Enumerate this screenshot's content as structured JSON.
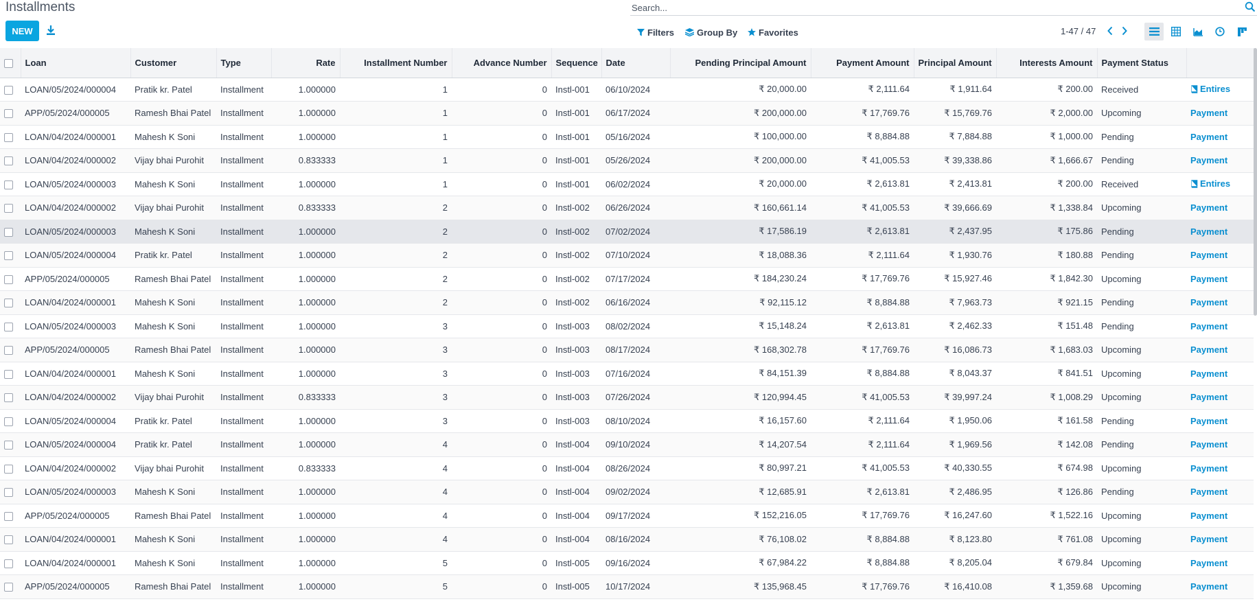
{
  "header": {
    "title": "Installments",
    "new_label": "NEW",
    "search_placeholder": "Search...",
    "filters_label": "Filters",
    "group_by_label": "Group By",
    "favorites_label": "Favorites",
    "pager": "1-47 / 47"
  },
  "colors": {
    "accent": "#0aa5e0",
    "link": "#0a8fd0"
  },
  "columns": [
    "Loan",
    "Customer",
    "Type",
    "Rate",
    "Installment Number",
    "Advance Number",
    "Sequence",
    "Date",
    "Pending Principal Amount",
    "Payment Amount",
    "Principal Amount",
    "Interests Amount",
    "Payment Status"
  ],
  "rows": [
    {
      "loan": "LOAN/05/2024/000004",
      "customer": "Pratik kr. Patel",
      "type": "Installment",
      "rate": "1.000000",
      "inst": "1",
      "adv": "0",
      "seq": "Instl-001",
      "date": "06/10/2024",
      "pending": "₹ 20,000.00",
      "payment": "₹ 2,111.64",
      "principal": "₹ 1,911.64",
      "interest": "₹ 200.00",
      "status": "Received",
      "action": "Entires"
    },
    {
      "loan": "APP/05/2024/000005",
      "customer": "Ramesh Bhai Patel",
      "type": "Installment",
      "rate": "1.000000",
      "inst": "1",
      "adv": "0",
      "seq": "Instl-001",
      "date": "06/17/2024",
      "pending": "₹ 200,000.00",
      "payment": "₹ 17,769.76",
      "principal": "₹ 15,769.76",
      "interest": "₹ 2,000.00",
      "status": "Upcoming",
      "action": "Payment"
    },
    {
      "loan": "LOAN/04/2024/000001",
      "customer": "Mahesh K Soni",
      "type": "Installment",
      "rate": "1.000000",
      "inst": "1",
      "adv": "0",
      "seq": "Instl-001",
      "date": "05/16/2024",
      "pending": "₹ 100,000.00",
      "payment": "₹ 8,884.88",
      "principal": "₹ 7,884.88",
      "interest": "₹ 1,000.00",
      "status": "Pending",
      "action": "Payment"
    },
    {
      "loan": "LOAN/04/2024/000002",
      "customer": "Vijay bhai Purohit",
      "type": "Installment",
      "rate": "0.833333",
      "inst": "1",
      "adv": "0",
      "seq": "Instl-001",
      "date": "05/26/2024",
      "pending": "₹ 200,000.00",
      "payment": "₹ 41,005.53",
      "principal": "₹ 39,338.86",
      "interest": "₹ 1,666.67",
      "status": "Pending",
      "action": "Payment"
    },
    {
      "loan": "LOAN/05/2024/000003",
      "customer": "Mahesh K Soni",
      "type": "Installment",
      "rate": "1.000000",
      "inst": "1",
      "adv": "0",
      "seq": "Instl-001",
      "date": "06/02/2024",
      "pending": "₹ 20,000.00",
      "payment": "₹ 2,613.81",
      "principal": "₹ 2,413.81",
      "interest": "₹ 200.00",
      "status": "Received",
      "action": "Entires"
    },
    {
      "loan": "LOAN/04/2024/000002",
      "customer": "Vijay bhai Purohit",
      "type": "Installment",
      "rate": "0.833333",
      "inst": "2",
      "adv": "0",
      "seq": "Instl-002",
      "date": "06/26/2024",
      "pending": "₹ 160,661.14",
      "payment": "₹ 41,005.53",
      "principal": "₹ 39,666.69",
      "interest": "₹ 1,338.84",
      "status": "Upcoming",
      "action": "Payment"
    },
    {
      "loan": "LOAN/05/2024/000003",
      "customer": "Mahesh K Soni",
      "type": "Installment",
      "rate": "1.000000",
      "inst": "2",
      "adv": "0",
      "seq": "Instl-002",
      "date": "07/02/2024",
      "pending": "₹ 17,586.19",
      "payment": "₹ 2,613.81",
      "principal": "₹ 2,437.95",
      "interest": "₹ 175.86",
      "status": "Pending",
      "action": "Payment"
    },
    {
      "loan": "LOAN/05/2024/000004",
      "customer": "Pratik kr. Patel",
      "type": "Installment",
      "rate": "1.000000",
      "inst": "2",
      "adv": "0",
      "seq": "Instl-002",
      "date": "07/10/2024",
      "pending": "₹ 18,088.36",
      "payment": "₹ 2,111.64",
      "principal": "₹ 1,930.76",
      "interest": "₹ 180.88",
      "status": "Pending",
      "action": "Payment"
    },
    {
      "loan": "APP/05/2024/000005",
      "customer": "Ramesh Bhai Patel",
      "type": "Installment",
      "rate": "1.000000",
      "inst": "2",
      "adv": "0",
      "seq": "Instl-002",
      "date": "07/17/2024",
      "pending": "₹ 184,230.24",
      "payment": "₹ 17,769.76",
      "principal": "₹ 15,927.46",
      "interest": "₹ 1,842.30",
      "status": "Upcoming",
      "action": "Payment"
    },
    {
      "loan": "LOAN/04/2024/000001",
      "customer": "Mahesh K Soni",
      "type": "Installment",
      "rate": "1.000000",
      "inst": "2",
      "adv": "0",
      "seq": "Instl-002",
      "date": "06/16/2024",
      "pending": "₹ 92,115.12",
      "payment": "₹ 8,884.88",
      "principal": "₹ 7,963.73",
      "interest": "₹ 921.15",
      "status": "Pending",
      "action": "Payment"
    },
    {
      "loan": "LOAN/05/2024/000003",
      "customer": "Mahesh K Soni",
      "type": "Installment",
      "rate": "1.000000",
      "inst": "3",
      "adv": "0",
      "seq": "Instl-003",
      "date": "08/02/2024",
      "pending": "₹ 15,148.24",
      "payment": "₹ 2,613.81",
      "principal": "₹ 2,462.33",
      "interest": "₹ 151.48",
      "status": "Pending",
      "action": "Payment"
    },
    {
      "loan": "APP/05/2024/000005",
      "customer": "Ramesh Bhai Patel",
      "type": "Installment",
      "rate": "1.000000",
      "inst": "3",
      "adv": "0",
      "seq": "Instl-003",
      "date": "08/17/2024",
      "pending": "₹ 168,302.78",
      "payment": "₹ 17,769.76",
      "principal": "₹ 16,086.73",
      "interest": "₹ 1,683.03",
      "status": "Upcoming",
      "action": "Payment"
    },
    {
      "loan": "LOAN/04/2024/000001",
      "customer": "Mahesh K Soni",
      "type": "Installment",
      "rate": "1.000000",
      "inst": "3",
      "adv": "0",
      "seq": "Instl-003",
      "date": "07/16/2024",
      "pending": "₹ 84,151.39",
      "payment": "₹ 8,884.88",
      "principal": "₹ 8,043.37",
      "interest": "₹ 841.51",
      "status": "Upcoming",
      "action": "Payment"
    },
    {
      "loan": "LOAN/04/2024/000002",
      "customer": "Vijay bhai Purohit",
      "type": "Installment",
      "rate": "0.833333",
      "inst": "3",
      "adv": "0",
      "seq": "Instl-003",
      "date": "07/26/2024",
      "pending": "₹ 120,994.45",
      "payment": "₹ 41,005.53",
      "principal": "₹ 39,997.24",
      "interest": "₹ 1,008.29",
      "status": "Upcoming",
      "action": "Payment"
    },
    {
      "loan": "LOAN/05/2024/000004",
      "customer": "Pratik kr. Patel",
      "type": "Installment",
      "rate": "1.000000",
      "inst": "3",
      "adv": "0",
      "seq": "Instl-003",
      "date": "08/10/2024",
      "pending": "₹ 16,157.60",
      "payment": "₹ 2,111.64",
      "principal": "₹ 1,950.06",
      "interest": "₹ 161.58",
      "status": "Pending",
      "action": "Payment"
    },
    {
      "loan": "LOAN/05/2024/000004",
      "customer": "Pratik kr. Patel",
      "type": "Installment",
      "rate": "1.000000",
      "inst": "4",
      "adv": "0",
      "seq": "Instl-004",
      "date": "09/10/2024",
      "pending": "₹ 14,207.54",
      "payment": "₹ 2,111.64",
      "principal": "₹ 1,969.56",
      "interest": "₹ 142.08",
      "status": "Pending",
      "action": "Payment"
    },
    {
      "loan": "LOAN/04/2024/000002",
      "customer": "Vijay bhai Purohit",
      "type": "Installment",
      "rate": "0.833333",
      "inst": "4",
      "adv": "0",
      "seq": "Instl-004",
      "date": "08/26/2024",
      "pending": "₹ 80,997.21",
      "payment": "₹ 41,005.53",
      "principal": "₹ 40,330.55",
      "interest": "₹ 674.98",
      "status": "Upcoming",
      "action": "Payment"
    },
    {
      "loan": "LOAN/05/2024/000003",
      "customer": "Mahesh K Soni",
      "type": "Installment",
      "rate": "1.000000",
      "inst": "4",
      "adv": "0",
      "seq": "Instl-004",
      "date": "09/02/2024",
      "pending": "₹ 12,685.91",
      "payment": "₹ 2,613.81",
      "principal": "₹ 2,486.95",
      "interest": "₹ 126.86",
      "status": "Pending",
      "action": "Payment"
    },
    {
      "loan": "APP/05/2024/000005",
      "customer": "Ramesh Bhai Patel",
      "type": "Installment",
      "rate": "1.000000",
      "inst": "4",
      "adv": "0",
      "seq": "Instl-004",
      "date": "09/17/2024",
      "pending": "₹ 152,216.05",
      "payment": "₹ 17,769.76",
      "principal": "₹ 16,247.60",
      "interest": "₹ 1,522.16",
      "status": "Upcoming",
      "action": "Payment"
    },
    {
      "loan": "LOAN/04/2024/000001",
      "customer": "Mahesh K Soni",
      "type": "Installment",
      "rate": "1.000000",
      "inst": "4",
      "adv": "0",
      "seq": "Instl-004",
      "date": "08/16/2024",
      "pending": "₹ 76,108.02",
      "payment": "₹ 8,884.88",
      "principal": "₹ 8,123.80",
      "interest": "₹ 761.08",
      "status": "Upcoming",
      "action": "Payment"
    },
    {
      "loan": "LOAN/04/2024/000001",
      "customer": "Mahesh K Soni",
      "type": "Installment",
      "rate": "1.000000",
      "inst": "5",
      "adv": "0",
      "seq": "Instl-005",
      "date": "09/16/2024",
      "pending": "₹ 67,984.22",
      "payment": "₹ 8,884.88",
      "principal": "₹ 8,205.04",
      "interest": "₹ 679.84",
      "status": "Upcoming",
      "action": "Payment"
    },
    {
      "loan": "APP/05/2024/000005",
      "customer": "Ramesh Bhai Patel",
      "type": "Installment",
      "rate": "1.000000",
      "inst": "5",
      "adv": "0",
      "seq": "Instl-005",
      "date": "10/17/2024",
      "pending": "₹ 135,968.45",
      "payment": "₹ 17,769.76",
      "principal": "₹ 16,410.08",
      "interest": "₹ 1,359.68",
      "status": "Upcoming",
      "action": "Payment"
    }
  ]
}
